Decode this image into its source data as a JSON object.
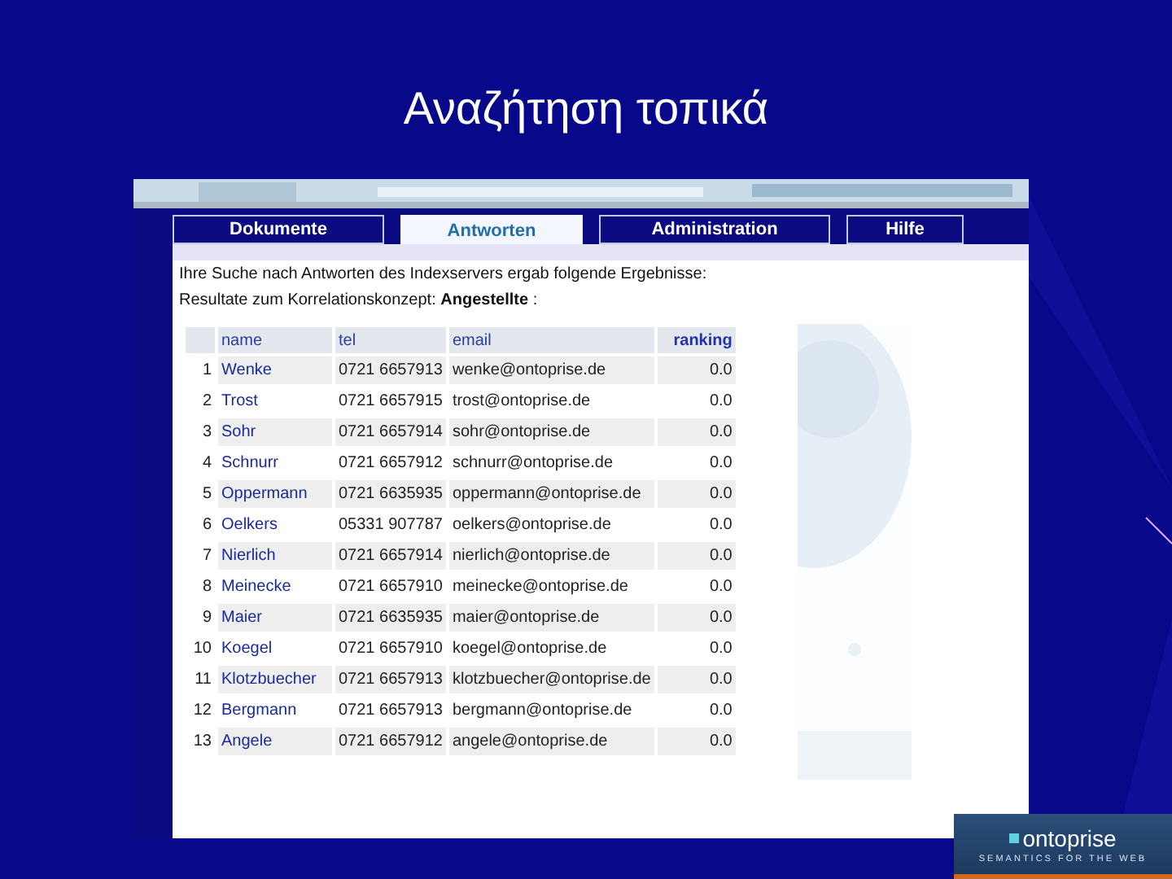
{
  "slide": {
    "title": "Αναζήτηση τοπικά"
  },
  "tabs": [
    {
      "label": "Dokumente",
      "selected": false
    },
    {
      "label": "Antworten",
      "selected": true
    },
    {
      "label": "Administration",
      "selected": false
    },
    {
      "label": "Hilfe",
      "selected": false
    }
  ],
  "intro": "Ihre Suche nach Antworten des Indexservers ergab folgende Ergebnisse:",
  "result_line": "Resultate zum Korrelationskonzept: **Angestellte** :",
  "table": {
    "columns": [
      "name",
      "tel",
      "email",
      "ranking"
    ],
    "rows": [
      {
        "index": "1",
        "name": "Wenke",
        "tel": "0721 6657913",
        "email": "wenke@ontoprise.de",
        "ranking": "0.0"
      },
      {
        "index": "2",
        "name": "Trost",
        "tel": "0721 6657915",
        "email": "trost@ontoprise.de",
        "ranking": "0.0"
      },
      {
        "index": "3",
        "name": "Sohr",
        "tel": "0721 6657914",
        "email": "sohr@ontoprise.de",
        "ranking": "0.0"
      },
      {
        "index": "4",
        "name": "Schnurr",
        "tel": "0721 6657912",
        "email": "schnurr@ontoprise.de",
        "ranking": "0.0"
      },
      {
        "index": "5",
        "name": "Oppermann",
        "tel": "0721 6635935",
        "email": "oppermann@ontoprise.de",
        "ranking": "0.0"
      },
      {
        "index": "6",
        "name": "Oelkers",
        "tel": "05331 907787",
        "email": "oelkers@ontoprise.de",
        "ranking": "0.0"
      },
      {
        "index": "7",
        "name": "Nierlich",
        "tel": "0721 6657914",
        "email": "nierlich@ontoprise.de",
        "ranking": "0.0"
      },
      {
        "index": "8",
        "name": "Meinecke",
        "tel": "0721 6657910",
        "email": "meinecke@ontoprise.de",
        "ranking": "0.0"
      },
      {
        "index": "9",
        "name": "Maier",
        "tel": "0721 6635935",
        "email": "maier@ontoprise.de",
        "ranking": "0.0"
      },
      {
        "index": "10",
        "name": "Koegel",
        "tel": "0721 6657910",
        "email": "koegel@ontoprise.de",
        "ranking": "0.0"
      },
      {
        "index": "11",
        "name": "Klotzbuecher",
        "tel": "0721 6657913",
        "email": "klotzbuecher@ontoprise.de",
        "ranking": "0.0"
      },
      {
        "index": "12",
        "name": "Bergmann",
        "tel": "0721 6657913",
        "email": "bergmann@ontoprise.de",
        "ranking": "0.0"
      },
      {
        "index": "13",
        "name": "Angele",
        "tel": "0721 6657912",
        "email": "angele@ontoprise.de",
        "ranking": "0.0"
      }
    ]
  },
  "logo": {
    "name": "ontoprise",
    "tagline": "SEMANTICS FOR THE WEB"
  }
}
